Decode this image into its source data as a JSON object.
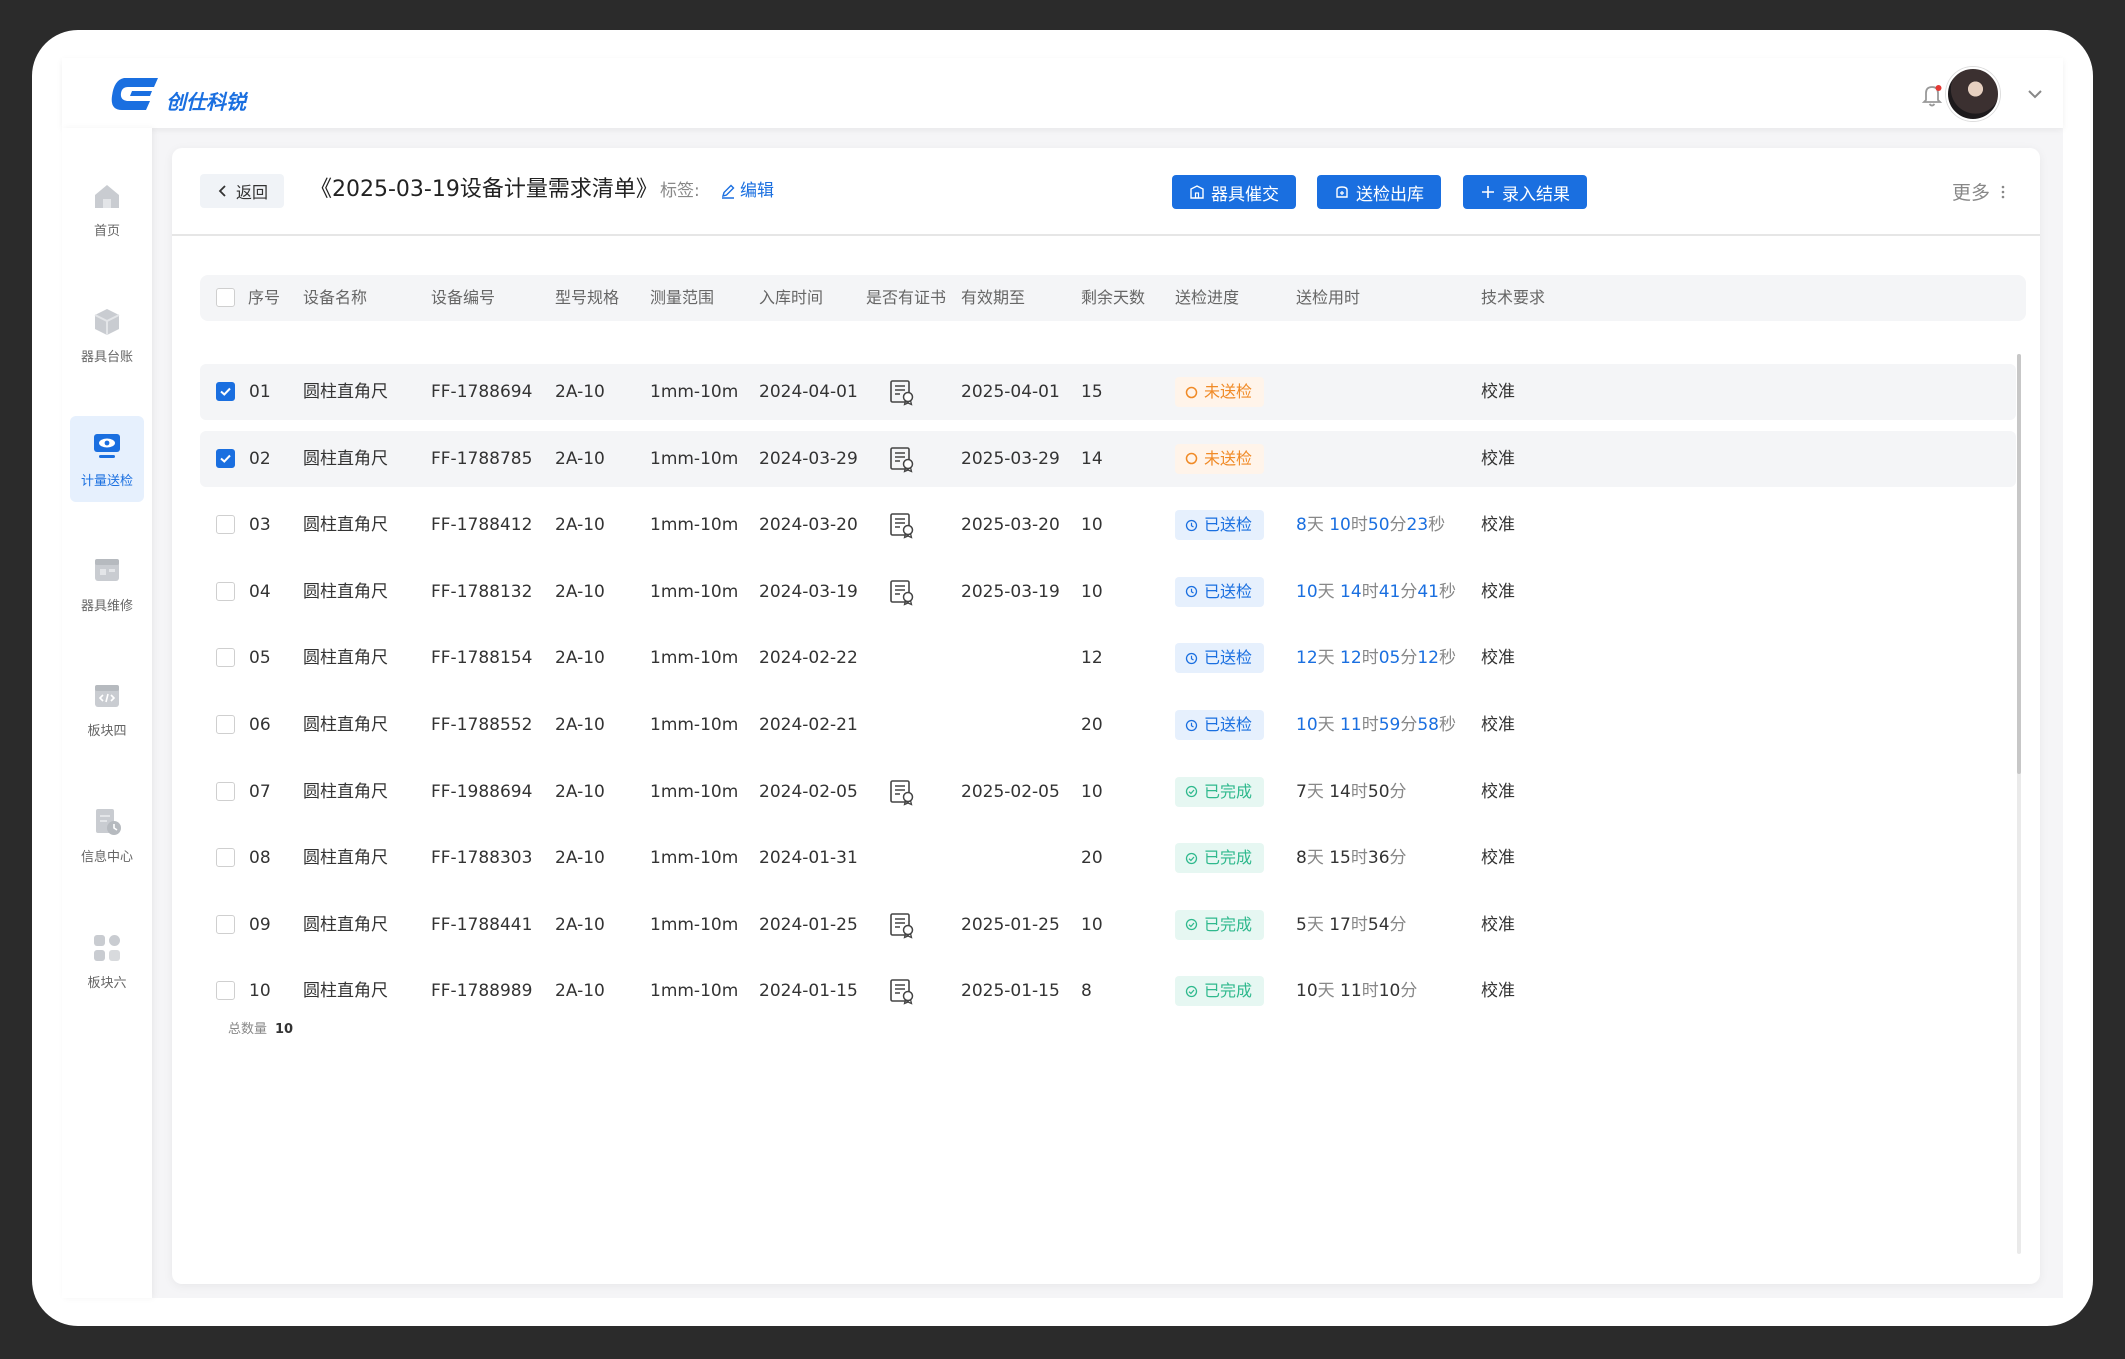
{
  "app": {
    "logo_text": "创仕科锐"
  },
  "header": {
    "bell_icon": "bell-icon",
    "user_menu_icon": "chevron-down-icon"
  },
  "sidebar": {
    "items": [
      {
        "label": "首页",
        "icon": "home-icon",
        "active": false
      },
      {
        "label": "器具台账",
        "icon": "box-icon",
        "active": false
      },
      {
        "label": "计量送检",
        "icon": "monitor-eye-icon",
        "active": true
      },
      {
        "label": "器具维修",
        "icon": "repair-icon",
        "active": false
      },
      {
        "label": "板块四",
        "icon": "code-window-icon",
        "active": false
      },
      {
        "label": "信息中心",
        "icon": "info-doc-icon",
        "active": false
      },
      {
        "label": "板块六",
        "icon": "grid-icon",
        "active": false
      }
    ]
  },
  "page": {
    "back_label": "返回",
    "title": "《2025-03-19设备计量需求清单》",
    "tag_label": "标签:",
    "tag_edit": "编辑",
    "buttons": {
      "urge": "器具催交",
      "ship": "送检出库",
      "record": "录入结果"
    },
    "more": "更多"
  },
  "table": {
    "headers": [
      "序号",
      "设备名称",
      "设备编号",
      "型号规格",
      "测量范围",
      "入库时间",
      "是否有证书",
      "有效期至",
      "剩余天数",
      "送检进度",
      "送检用时",
      "技术要求"
    ],
    "rows": [
      {
        "no": "01",
        "name": "圆柱直角尺",
        "code": "FF-1788694",
        "model": "2A-10",
        "range": "1mm-10m",
        "in_date": "2024-04-01",
        "cert": true,
        "valid": "2025-04-01",
        "days": "15",
        "status": "未送检",
        "status_type": "pending",
        "dur": {
          "d": "",
          "h": "",
          "m": "",
          "s": ""
        },
        "req": "校准",
        "checked": true
      },
      {
        "no": "02",
        "name": "圆柱直角尺",
        "code": "FF-1788785",
        "model": "2A-10",
        "range": "1mm-10m",
        "in_date": "2024-03-29",
        "cert": true,
        "valid": "2025-03-29",
        "days": "14",
        "status": "未送检",
        "status_type": "pending",
        "dur": {
          "d": "",
          "h": "",
          "m": "",
          "s": ""
        },
        "req": "校准",
        "checked": true
      },
      {
        "no": "03",
        "name": "圆柱直角尺",
        "code": "FF-1788412",
        "model": "2A-10",
        "range": "1mm-10m",
        "in_date": "2024-03-20",
        "cert": true,
        "valid": "2025-03-20",
        "days": "10",
        "status": "已送检",
        "status_type": "sent",
        "dur": {
          "d": "8",
          "h": "10",
          "m": "50",
          "s": "23"
        },
        "req": "校准",
        "checked": false
      },
      {
        "no": "04",
        "name": "圆柱直角尺",
        "code": "FF-1788132",
        "model": "2A-10",
        "range": "1mm-10m",
        "in_date": "2024-03-19",
        "cert": true,
        "valid": "2025-03-19",
        "days": "10",
        "status": "已送检",
        "status_type": "sent",
        "dur": {
          "d": "10",
          "h": "14",
          "m": "41",
          "s": "41"
        },
        "req": "校准",
        "checked": false
      },
      {
        "no": "05",
        "name": "圆柱直角尺",
        "code": "FF-1788154",
        "model": "2A-10",
        "range": "1mm-10m",
        "in_date": "2024-02-22",
        "cert": false,
        "valid": "",
        "days": "12",
        "status": "已送检",
        "status_type": "sent",
        "dur": {
          "d": "12",
          "h": "12",
          "m": "05",
          "s": "12"
        },
        "req": "校准",
        "checked": false
      },
      {
        "no": "06",
        "name": "圆柱直角尺",
        "code": "FF-1788552",
        "model": "2A-10",
        "range": "1mm-10m",
        "in_date": "2024-02-21",
        "cert": false,
        "valid": "",
        "days": "20",
        "status": "已送检",
        "status_type": "sent",
        "dur": {
          "d": "10",
          "h": "11",
          "m": "59",
          "s": "58"
        },
        "req": "校准",
        "checked": false
      },
      {
        "no": "07",
        "name": "圆柱直角尺",
        "code": "FF-1988694",
        "model": "2A-10",
        "range": "1mm-10m",
        "in_date": "2024-02-05",
        "cert": true,
        "valid": "2025-02-05",
        "days": "10",
        "status": "已完成",
        "status_type": "done",
        "dur": {
          "d": "7",
          "h": "14",
          "m": "50",
          "s": ""
        },
        "req": "校准",
        "checked": false
      },
      {
        "no": "08",
        "name": "圆柱直角尺",
        "code": "FF-1788303",
        "model": "2A-10",
        "range": "1mm-10m",
        "in_date": "2024-01-31",
        "cert": false,
        "valid": "",
        "days": "20",
        "status": "已完成",
        "status_type": "done",
        "dur": {
          "d": "8",
          "h": "15",
          "m": "36",
          "s": ""
        },
        "req": "校准",
        "checked": false
      },
      {
        "no": "09",
        "name": "圆柱直角尺",
        "code": "FF-1788441",
        "model": "2A-10",
        "range": "1mm-10m",
        "in_date": "2024-01-25",
        "cert": true,
        "valid": "2025-01-25",
        "days": "10",
        "status": "已完成",
        "status_type": "done",
        "dur": {
          "d": "5",
          "h": "17",
          "m": "54",
          "s": ""
        },
        "req": "校准",
        "checked": false
      },
      {
        "no": "10",
        "name": "圆柱直角尺",
        "code": "FF-1788989",
        "model": "2A-10",
        "range": "1mm-10m",
        "in_date": "2024-01-15",
        "cert": true,
        "valid": "2025-01-15",
        "days": "8",
        "status": "已完成",
        "status_type": "done",
        "dur": {
          "d": "10",
          "h": "11",
          "m": "10",
          "s": ""
        },
        "req": "校准",
        "checked": false
      }
    ],
    "units": {
      "d": "天",
      "h": "时",
      "m": "分",
      "s": "秒"
    },
    "total_label": "总数量",
    "total_value": "10"
  },
  "colors": {
    "primary": "#1a6fe0",
    "pending": "#f08a26",
    "done": "#2fb98d"
  }
}
